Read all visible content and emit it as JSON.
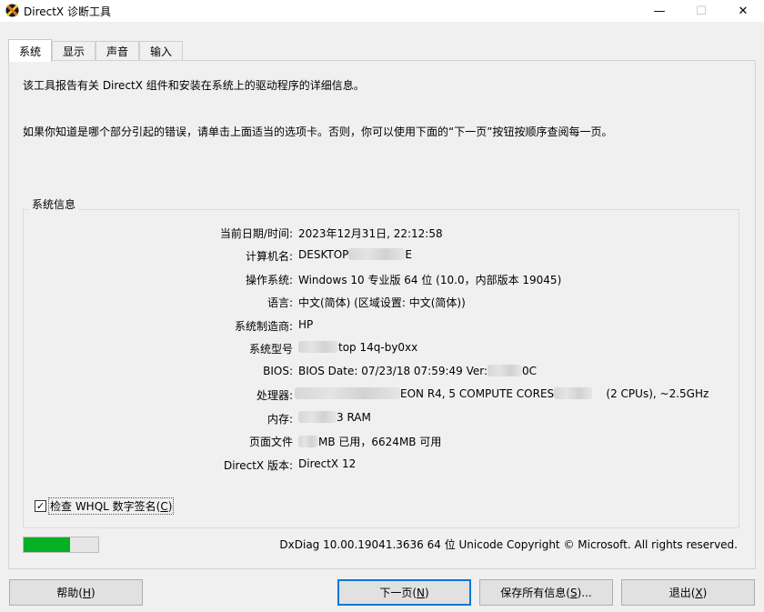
{
  "window": {
    "title": "DirectX 诊断工具",
    "minimize_glyph": "—",
    "maximize_glyph": "☐",
    "close_glyph": "✕"
  },
  "tabs": [
    {
      "label": "系统",
      "active": true
    },
    {
      "label": "显示",
      "active": false
    },
    {
      "label": "声音",
      "active": false
    },
    {
      "label": "输入",
      "active": false
    }
  ],
  "intro": {
    "line1": "该工具报告有关 DirectX 组件和安装在系统上的驱动程序的详细信息。",
    "line2": "如果你知道是哪个部分引起的错误，请单击上面适当的选项卡。否则，你可以使用下面的“下一页”按钮按顺序查阅每一页。"
  },
  "system_info": {
    "title": "系统信息",
    "rows": [
      {
        "label": "当前日期/时间:",
        "value": "2023年12月31日, 22:12:58"
      },
      {
        "label": "计算机名:",
        "value_pre": "DESKTOP",
        "value_post": "E"
      },
      {
        "label": "操作系统:",
        "value": "Windows 10 专业版 64 位 (10.0，内部版本 19045)"
      },
      {
        "label": "语言:",
        "value": "中文(简体) (区域设置: 中文(简体))"
      },
      {
        "label": "系统制造商:",
        "value": "HP"
      },
      {
        "label": "系统型号",
        "value_pre": "",
        "value_post": "top 14q-by0xx"
      },
      {
        "label": "BIOS:",
        "value_pre": "BIOS Date: 07/23/18 07:59:49 Ver:",
        "value_post": "0C"
      },
      {
        "label": "处理器:",
        "value_pre": "",
        "value_mid": "EON R4, 5 COMPUTE CORES",
        "value_post": "(2 CPUs), ~2.5GHz"
      },
      {
        "label": "内存:",
        "value_pre": "",
        "value_post": "3 RAM"
      },
      {
        "label": "页面文件",
        "value_pre": "",
        "value_post": "MB 已用，6624MB 可用"
      },
      {
        "label": "DirectX 版本:",
        "value": "DirectX 12"
      }
    ]
  },
  "whql": {
    "checked": true,
    "check_glyph": "✓",
    "label": "检查 WHQL 数字签名(",
    "accel": "C",
    "label_end": ")"
  },
  "progress": {
    "percent": 62,
    "color": "#06b025"
  },
  "footer": "DxDiag 10.00.19041.3636 64 位 Unicode  Copyright © Microsoft. All rights reserved.",
  "buttons": {
    "help": {
      "label": "帮助(",
      "accel": "H",
      "end": ")"
    },
    "next": {
      "label": "下一页(",
      "accel": "N",
      "end": ")"
    },
    "save": {
      "label": "保存所有信息(",
      "accel": "S",
      "end": ")..."
    },
    "exit": {
      "label": "退出(",
      "accel": "X",
      "end": ")"
    }
  }
}
